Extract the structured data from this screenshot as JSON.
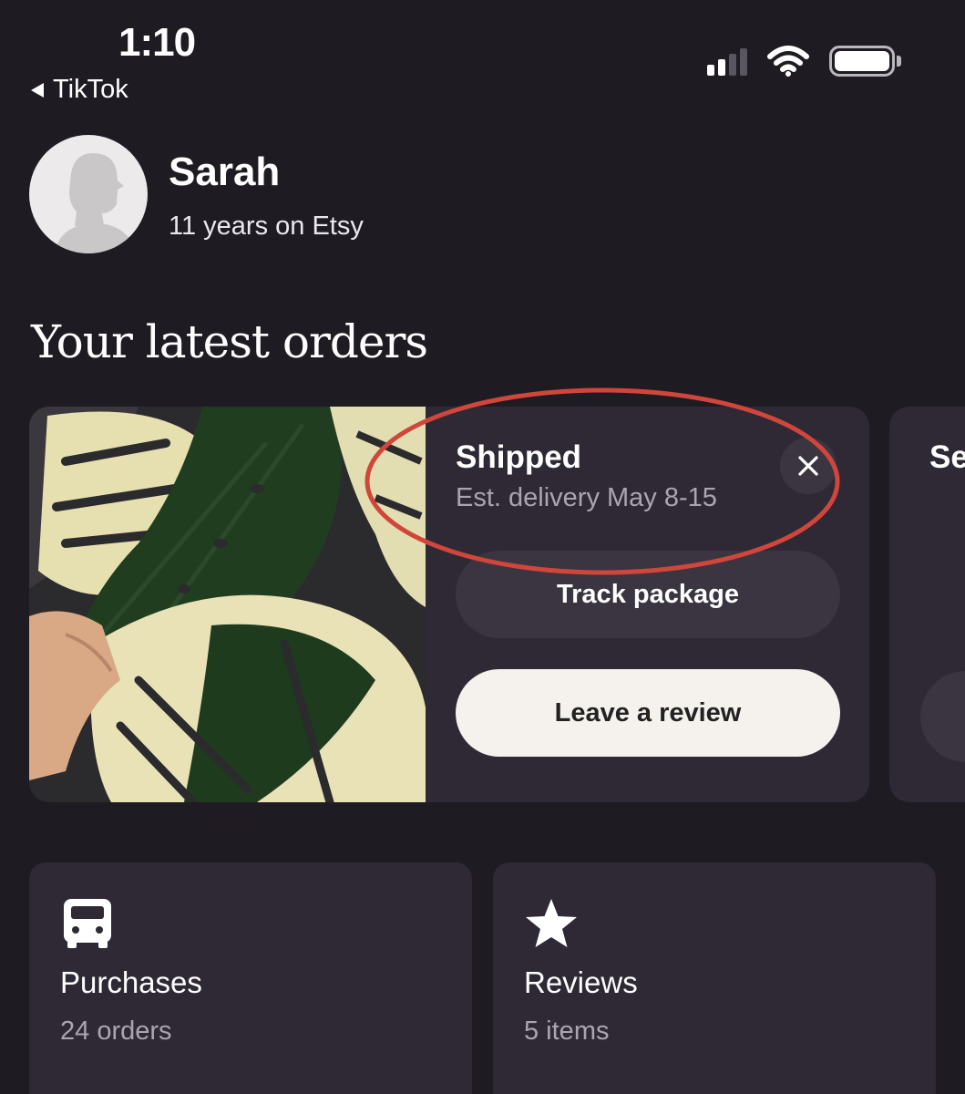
{
  "status_bar": {
    "time": "1:10",
    "back_label": "TikTok"
  },
  "profile": {
    "name": "Sarah",
    "meta": "11 years on Etsy"
  },
  "orders_section": {
    "title": "Your latest orders",
    "order": {
      "status": "Shipped",
      "delivery": "Est. delivery May 8-15",
      "track_label": "Track package",
      "review_label": "Leave a review",
      "image_icon": "monstera-plant-photo"
    },
    "next_order_status_partial": "Se"
  },
  "tiles": [
    {
      "icon": "truck-icon",
      "title": "Purchases",
      "subtitle": "24 orders"
    },
    {
      "icon": "star-icon",
      "title": "Reviews",
      "subtitle": "5 items"
    }
  ],
  "colors": {
    "background": "#1f1b23",
    "card": "#2e2935",
    "button_dark": "#3a3541",
    "button_light": "#f5f2ed",
    "highlight_ring": "#d0463b",
    "leaf_cream": "#e8e3b4",
    "leaf_green": "#1e3a1f"
  }
}
